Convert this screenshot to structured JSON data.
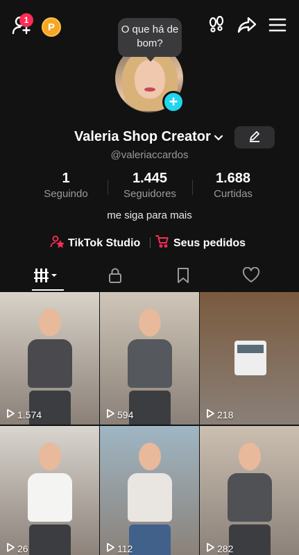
{
  "header": {
    "notification_count": "1",
    "coin_label": "P"
  },
  "bubble_text": "O que há de bom?",
  "profile": {
    "display_name": "Valeria Shop Creator",
    "username": "@valeriaccardos",
    "bio": "me siga para mais"
  },
  "stats": [
    {
      "value": "1",
      "label": "Seguindo"
    },
    {
      "value": "1.445",
      "label": "Seguidores"
    },
    {
      "value": "1.688",
      "label": "Curtidas"
    }
  ],
  "links": {
    "studio": "TikTok Studio",
    "orders": "Seus pedidos"
  },
  "tabs": [
    "videos-grid-icon",
    "lock-icon",
    "bookmark-icon",
    "heart-icon"
  ],
  "videos": [
    {
      "views": "1.574",
      "bg": "#d8d2c8",
      "top": "#4a4a4e"
    },
    {
      "views": "594",
      "bg": "#cfc6b8",
      "top": "#55585c"
    },
    {
      "views": "218",
      "bg": "#7a5a3e",
      "top": "#eeeeee"
    },
    {
      "views": "26",
      "bg": "#d9d5cf",
      "top": "#f4f4f2"
    },
    {
      "views": "112",
      "bg": "#9fb6c4",
      "top": "#e9e6e2"
    },
    {
      "views": "282",
      "bg": "#cbbfb0",
      "top": "#4f5155"
    }
  ],
  "colors": {
    "accent_red": "#fe2c55",
    "cyan": "#20d5ec",
    "coin": "#f5a623"
  }
}
